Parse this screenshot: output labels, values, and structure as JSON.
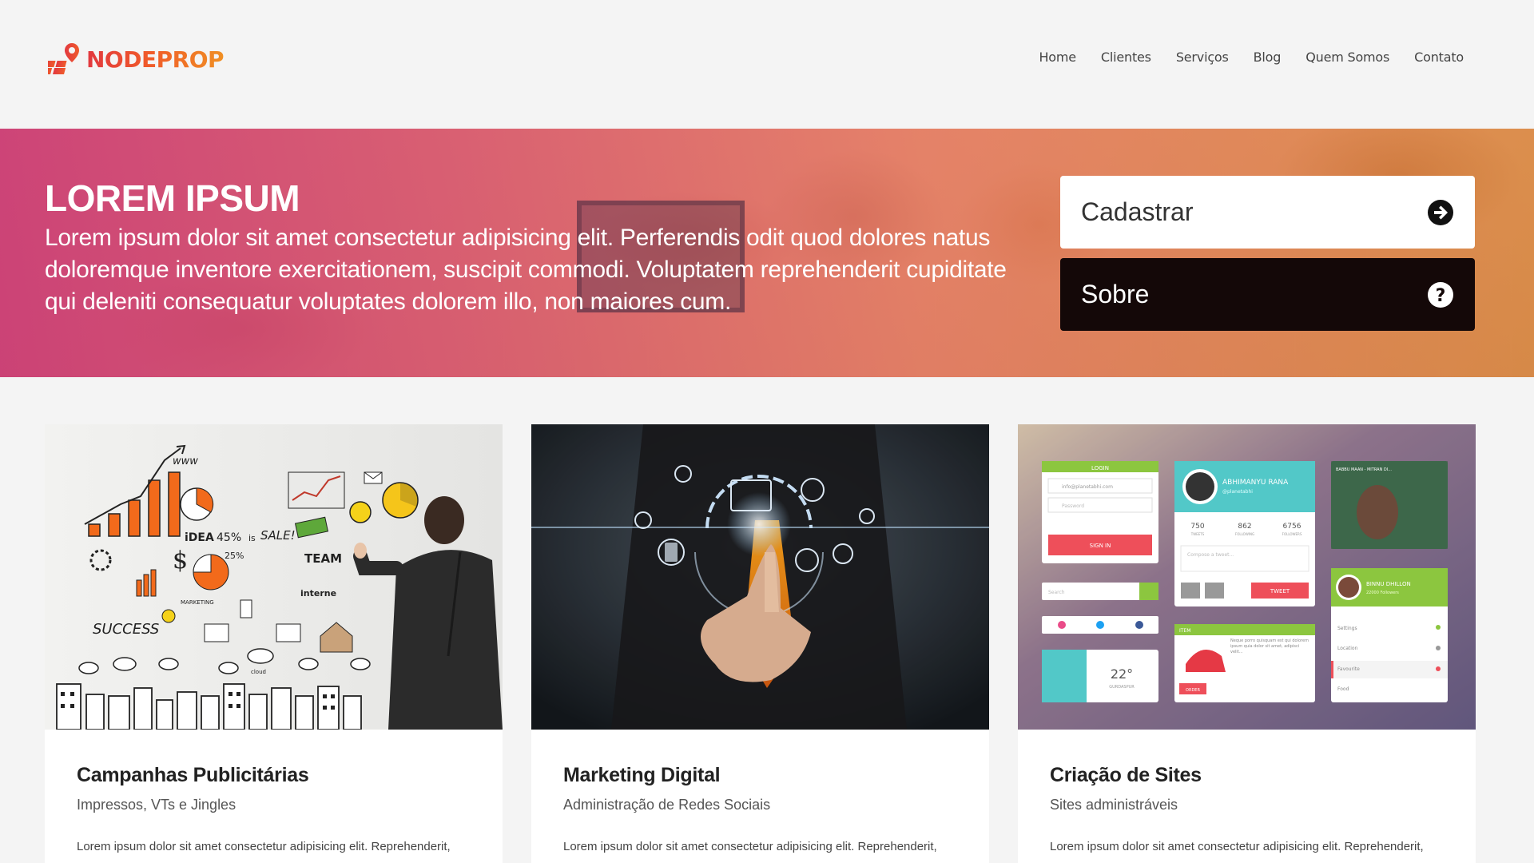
{
  "header": {
    "logo_text": "NODEPROP",
    "brand_colors": [
      "#e2383f",
      "#f08f23"
    ],
    "nav": [
      {
        "label": "Home"
      },
      {
        "label": "Clientes"
      },
      {
        "label": "Serviços"
      },
      {
        "label": "Blog"
      },
      {
        "label": "Quem Somos"
      },
      {
        "label": "Contato"
      }
    ]
  },
  "hero": {
    "title": "LOREM IPSUM",
    "text": "Lorem ipsum dolor sit amet consectetur adipisicing elit. Perferendis odit quod dolores natus doloremque inventore exercitationem, suscipit commodi. Voluptatem reprehenderit cupiditate qui deleniti consequatur voluptates dolorem illo, non maiores cum.",
    "gradient": [
      "#ca376e",
      "#d67828"
    ],
    "buttons": [
      {
        "label": "Cadastrar",
        "icon": "arrow-right-circle-icon"
      },
      {
        "label": "Sobre",
        "icon": "question-circle-icon"
      }
    ]
  },
  "cards": [
    {
      "title": "Campanhas Publicitárias",
      "subtitle": "Impressos, VTs e Jingles",
      "body": "Lorem ipsum dolor sit amet consectetur adipisicing elit. Reprehenderit,",
      "image_labels": [
        "www",
        "iDEA",
        "45%",
        "is",
        "SALE!",
        "25%",
        "TEAM",
        "interne",
        "SUCCESS",
        "MARKETING",
        "cloud"
      ]
    },
    {
      "title": "Marketing Digital",
      "subtitle": "Administração de Redes Sociais",
      "body": "Lorem ipsum dolor sit amet consectetur adipisicing elit. Reprehenderit,"
    },
    {
      "title": "Criação de Sites",
      "subtitle": "Sites administráveis",
      "body": "Lorem ipsum dolor sit amet consectetur adipisicing elit. Reprehenderit,",
      "image_labels": {
        "login": "LOGIN",
        "email": "info@planetabhi.com",
        "password": "Password",
        "sign_in": "SIGN IN",
        "profile_name": "ABHIMANYU RANA",
        "profile_handle": "@planetabhi",
        "stats": [
          "750",
          "862",
          "6756"
        ],
        "stat_labels": [
          "TWEETS",
          "FOLLOWING",
          "FOLLOWERS"
        ],
        "compose": "Compose a tweet...",
        "tweet": "TWEET",
        "search": "Search",
        "temperature": "22°",
        "city": "GURDASPUR",
        "item": "ITEM",
        "order": "ORDER",
        "item_text": "Neque porro quisquam est qui dolorem ipsum quia dolor sit amet, adipisci velit...",
        "video_title": "BABBU MAAN - MITRAN DI...",
        "profile2_name": "BINNU DHILLON",
        "profile2_followers": "22000 Followers",
        "menu": [
          "Settings",
          "Location",
          "Favourite",
          "Food"
        ]
      }
    }
  ]
}
